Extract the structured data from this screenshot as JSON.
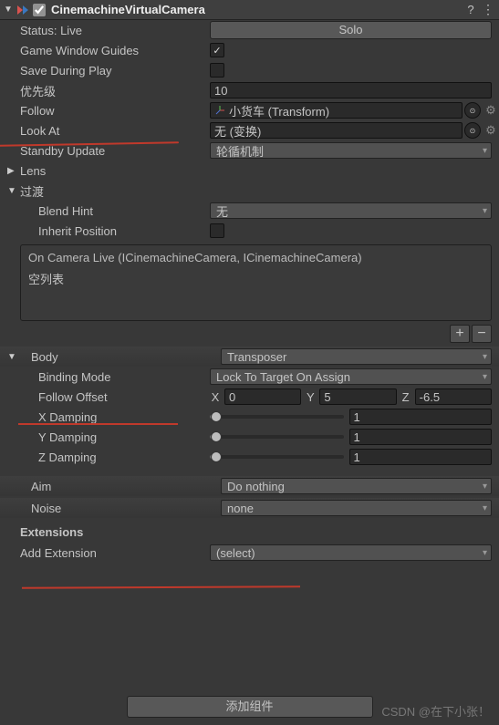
{
  "header": {
    "title": "CinemachineVirtualCamera",
    "enabled_checked": true
  },
  "status": {
    "label": "Status: Live",
    "solo_btn": "Solo"
  },
  "guides": {
    "label": "Game Window Guides",
    "checked": true
  },
  "saveplay": {
    "label": "Save During Play",
    "checked": false
  },
  "priority": {
    "label": "优先级",
    "value": "10"
  },
  "follow": {
    "label": "Follow",
    "target": "小货车 (Transform)"
  },
  "lookat": {
    "label": "Look At",
    "target": "无 (变换)"
  },
  "standby": {
    "label": "Standby Update",
    "value": "轮循机制"
  },
  "lens": {
    "label": "Lens"
  },
  "transitions": {
    "label": "过渡",
    "blend_hint": {
      "label": "Blend Hint",
      "value": "无"
    },
    "inherit": {
      "label": "Inherit Position",
      "checked": false
    },
    "event_title": "On Camera Live (ICinemachineCamera, ICinemachineCamera)",
    "empty_list": "空列表"
  },
  "body": {
    "label": "Body",
    "mode": "Transposer",
    "binding": {
      "label": "Binding Mode",
      "value": "Lock To Target On Assign"
    },
    "offset": {
      "label": "Follow Offset",
      "x": "0",
      "y": "5",
      "z": "-6.5"
    },
    "xdamp": {
      "label": "X Damping",
      "value": "1",
      "pct": 5
    },
    "ydamp": {
      "label": "Y Damping",
      "value": "1",
      "pct": 5
    },
    "zdamp": {
      "label": "Z Damping",
      "value": "1",
      "pct": 5
    }
  },
  "aim": {
    "label": "Aim",
    "value": "Do nothing"
  },
  "noise": {
    "label": "Noise",
    "value": "none"
  },
  "extensions": {
    "header": "Extensions",
    "add": {
      "label": "Add Extension",
      "value": "(select)"
    }
  },
  "add_component": "添加组件",
  "watermark": "CSDN @在下小张！",
  "axis_labels": {
    "x": "X",
    "y": "Y",
    "z": "Z"
  }
}
